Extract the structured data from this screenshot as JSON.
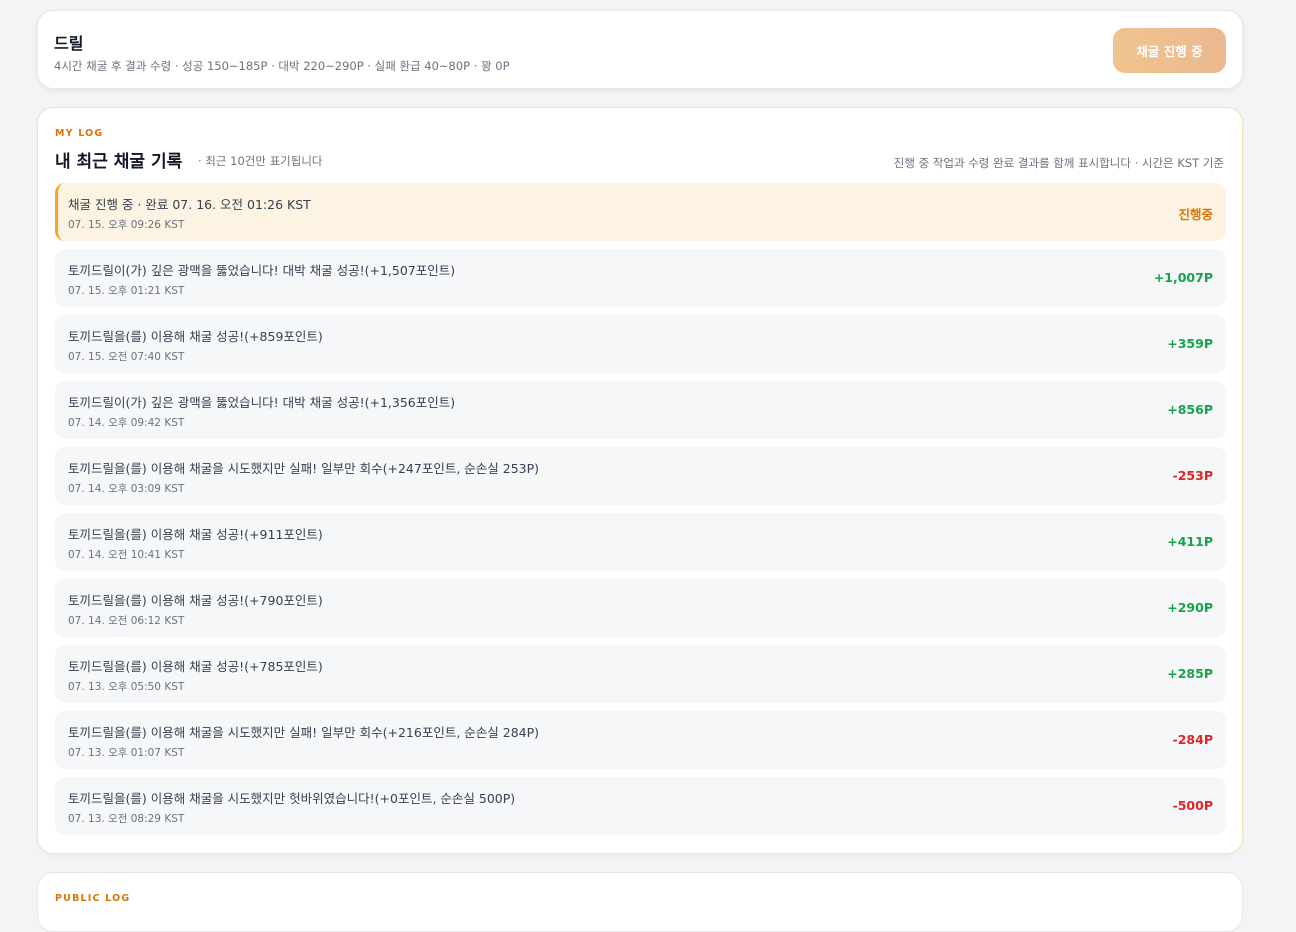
{
  "drill": {
    "title": "드릴",
    "desc": "4시간 채굴 후 결과 수령 · 성공 150~185P · 대박 220~290P · 실패 환급 40~80P · 꽝 0P",
    "button": "채굴 진행 중"
  },
  "log": {
    "eyebrow": "MY LOG",
    "title": "내 최근 채굴 기록",
    "subtitle": "· 최근 10건만 표기됩니다",
    "note": "진행 중 작업과 수령 완료 결과를 함께 표시합니다 · 시간은 KST 기준",
    "entries": [
      {
        "text": "채굴 진행 중 · 완료 07. 16. 오전 01:26 KST",
        "time": "07. 15. 오후 09:26 KST",
        "amount": "진행중",
        "kind": "progress"
      },
      {
        "text": "토끼드릴이(가) 깊은 광맥을 뚫었습니다! 대박 채굴 성공!(+1,507포인트)",
        "time": "07. 15. 오후 01:21 KST",
        "amount": "+1,007P",
        "kind": "pos"
      },
      {
        "text": "토끼드릴을(를) 이용해 채굴 성공!(+859포인트)",
        "time": "07. 15. 오전 07:40 KST",
        "amount": "+359P",
        "kind": "pos"
      },
      {
        "text": "토끼드릴이(가) 깊은 광맥을 뚫었습니다! 대박 채굴 성공!(+1,356포인트)",
        "time": "07. 14. 오후 09:42 KST",
        "amount": "+856P",
        "kind": "pos"
      },
      {
        "text": "토끼드릴을(를) 이용해 채굴을 시도했지만 실패! 일부만 회수(+247포인트, 순손실 253P)",
        "time": "07. 14. 오후 03:09 KST",
        "amount": "-253P",
        "kind": "neg"
      },
      {
        "text": "토끼드릴을(를) 이용해 채굴 성공!(+911포인트)",
        "time": "07. 14. 오전 10:41 KST",
        "amount": "+411P",
        "kind": "pos"
      },
      {
        "text": "토끼드릴을(를) 이용해 채굴 성공!(+790포인트)",
        "time": "07. 14. 오전 06:12 KST",
        "amount": "+290P",
        "kind": "pos"
      },
      {
        "text": "토끼드릴을(를) 이용해 채굴 성공!(+785포인트)",
        "time": "07. 13. 오후 05:50 KST",
        "amount": "+285P",
        "kind": "pos"
      },
      {
        "text": "토끼드릴을(를) 이용해 채굴을 시도했지만 실패! 일부만 회수(+216포인트, 순손실 284P)",
        "time": "07. 13. 오후 01:07 KST",
        "amount": "-284P",
        "kind": "neg"
      },
      {
        "text": "토끼드릴을(를) 이용해 채굴을 시도했지만 헛바위였습니다!(+0포인트, 순손실 500P)",
        "time": "07. 13. 오전 08:29 KST",
        "amount": "-500P",
        "kind": "neg"
      }
    ]
  },
  "public_log": {
    "eyebrow": "PUBLIC LOG"
  }
}
